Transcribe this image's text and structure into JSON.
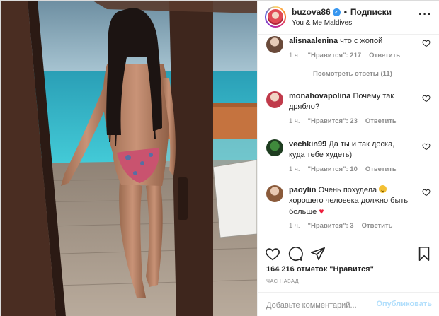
{
  "header": {
    "username": "buzova86",
    "separator": "•",
    "follow_label": "Подписки",
    "location": "You & Me Maldives"
  },
  "comments": [
    {
      "username": "alisnaalenina",
      "text": "что с жопой",
      "time": "1 ч.",
      "likes": "\"Нравится\": 217",
      "reply": "Ответить"
    },
    {
      "username": "monahovapolina",
      "text": "Почему так дрябло?",
      "time": "1 ч.",
      "likes": "\"Нравится\": 23",
      "reply": "Ответить"
    },
    {
      "username": "vechkin99",
      "text": "Да ты и так доска, куда тебе худеть)",
      "time": "1 ч.",
      "likes": "\"Нравится\": 10",
      "reply": "Ответить"
    },
    {
      "username": "paoylin",
      "text_before_emoji": "Очень похудела",
      "text_after_emoji": "хорошего человека должно быть больше",
      "time": "1 ч.",
      "likes": "\"Нравится\": 3",
      "reply": "Ответить"
    }
  ],
  "view_replies": "Посмотреть ответы (11)",
  "likes_summary": "164 216 отметок \"Нравится\"",
  "posted_time": "ЧАС НАЗАД",
  "add_comment": {
    "placeholder": "Добавьте комментарий...",
    "publish_label": "Опубликовать"
  },
  "colors": {
    "link": "#3897f0",
    "muted": "#8e8e8e",
    "publish_disabled": "#b2dffc",
    "heart": "#ed1c3a"
  }
}
